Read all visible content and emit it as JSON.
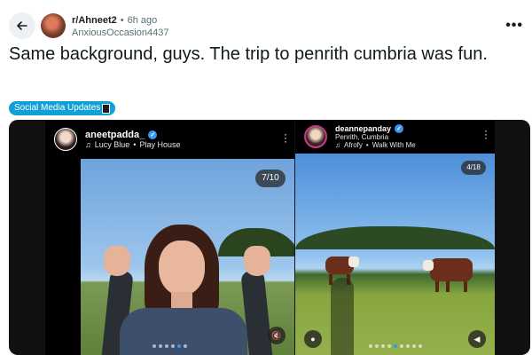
{
  "post": {
    "subreddit": "r/Ahneet2",
    "separator": "•",
    "time_ago": "6h ago",
    "author": "AnxiousOccasion4437",
    "title": "Same background, guys. The trip to penrith cumbria was fun.",
    "flair": "Social Media Updates",
    "more_label": "•••"
  },
  "icons": {
    "back": "arrow-left-icon",
    "more": "more-dots-icon",
    "verified": "verified-badge-icon",
    "music": "music-note-icon",
    "mute": "speaker-muted-icon",
    "user": "user-icon",
    "tv": "tv-emoji-icon"
  },
  "colors": {
    "flair_bg": "#11a0d6",
    "verified": "#3797f0",
    "media_bg": "#111111"
  },
  "left_card": {
    "username": "aneetpadda_",
    "music_prefix": "♫",
    "song": "Lucy Blue",
    "separator": "•",
    "artist": "Play House",
    "counter": "7/10",
    "dots_total": 6,
    "dots_active": 4
  },
  "right_card": {
    "username": "deannepanday",
    "location": "Penrith, Cumbria",
    "music_prefix": "♫",
    "song": "Afrofy",
    "separator": "•",
    "artist": "Walk With Me",
    "counter": "4/18",
    "dots_total": 9,
    "dots_active": 4
  }
}
